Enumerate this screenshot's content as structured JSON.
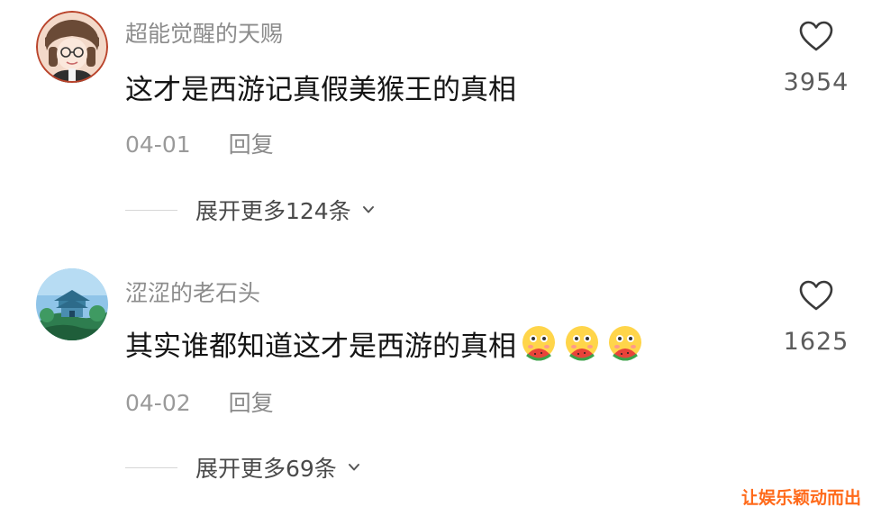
{
  "comments": [
    {
      "username": "超能觉醒的天赐",
      "text": "这才是西游记真假美猴王的真相",
      "date": "04-01",
      "reply_label": "回复",
      "like_count": "3954",
      "expand_label": "展开更多124条"
    },
    {
      "username": "涩涩的老石头",
      "text": "其实谁都知道这才是西游的真相",
      "date": "04-02",
      "reply_label": "回复",
      "like_count": "1625",
      "expand_label": "展开更多69条"
    }
  ],
  "watermark": "让娱乐颖动而出",
  "icons": {
    "like": "heart-outline-icon",
    "expand": "chevron-down-icon",
    "emoji": "eating-watermelon-emoji"
  },
  "colors": {
    "username": "#8c8c8c",
    "text": "#141414",
    "meta": "#9a9a9a",
    "watermark": "#ff6a1a"
  }
}
